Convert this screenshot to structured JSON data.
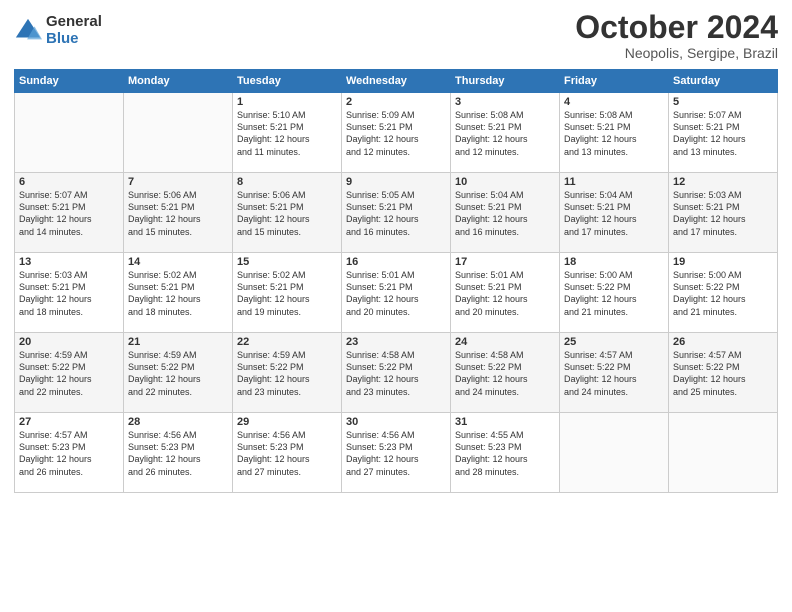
{
  "logo": {
    "general": "General",
    "blue": "Blue"
  },
  "header": {
    "title": "October 2024",
    "subtitle": "Neopolis, Sergipe, Brazil"
  },
  "weekdays": [
    "Sunday",
    "Monday",
    "Tuesday",
    "Wednesday",
    "Thursday",
    "Friday",
    "Saturday"
  ],
  "weeks": [
    [
      {
        "day": "",
        "info": ""
      },
      {
        "day": "",
        "info": ""
      },
      {
        "day": "1",
        "info": "Sunrise: 5:10 AM\nSunset: 5:21 PM\nDaylight: 12 hours\nand 11 minutes."
      },
      {
        "day": "2",
        "info": "Sunrise: 5:09 AM\nSunset: 5:21 PM\nDaylight: 12 hours\nand 12 minutes."
      },
      {
        "day": "3",
        "info": "Sunrise: 5:08 AM\nSunset: 5:21 PM\nDaylight: 12 hours\nand 12 minutes."
      },
      {
        "day": "4",
        "info": "Sunrise: 5:08 AM\nSunset: 5:21 PM\nDaylight: 12 hours\nand 13 minutes."
      },
      {
        "day": "5",
        "info": "Sunrise: 5:07 AM\nSunset: 5:21 PM\nDaylight: 12 hours\nand 13 minutes."
      }
    ],
    [
      {
        "day": "6",
        "info": "Sunrise: 5:07 AM\nSunset: 5:21 PM\nDaylight: 12 hours\nand 14 minutes."
      },
      {
        "day": "7",
        "info": "Sunrise: 5:06 AM\nSunset: 5:21 PM\nDaylight: 12 hours\nand 15 minutes."
      },
      {
        "day": "8",
        "info": "Sunrise: 5:06 AM\nSunset: 5:21 PM\nDaylight: 12 hours\nand 15 minutes."
      },
      {
        "day": "9",
        "info": "Sunrise: 5:05 AM\nSunset: 5:21 PM\nDaylight: 12 hours\nand 16 minutes."
      },
      {
        "day": "10",
        "info": "Sunrise: 5:04 AM\nSunset: 5:21 PM\nDaylight: 12 hours\nand 16 minutes."
      },
      {
        "day": "11",
        "info": "Sunrise: 5:04 AM\nSunset: 5:21 PM\nDaylight: 12 hours\nand 17 minutes."
      },
      {
        "day": "12",
        "info": "Sunrise: 5:03 AM\nSunset: 5:21 PM\nDaylight: 12 hours\nand 17 minutes."
      }
    ],
    [
      {
        "day": "13",
        "info": "Sunrise: 5:03 AM\nSunset: 5:21 PM\nDaylight: 12 hours\nand 18 minutes."
      },
      {
        "day": "14",
        "info": "Sunrise: 5:02 AM\nSunset: 5:21 PM\nDaylight: 12 hours\nand 18 minutes."
      },
      {
        "day": "15",
        "info": "Sunrise: 5:02 AM\nSunset: 5:21 PM\nDaylight: 12 hours\nand 19 minutes."
      },
      {
        "day": "16",
        "info": "Sunrise: 5:01 AM\nSunset: 5:21 PM\nDaylight: 12 hours\nand 20 minutes."
      },
      {
        "day": "17",
        "info": "Sunrise: 5:01 AM\nSunset: 5:21 PM\nDaylight: 12 hours\nand 20 minutes."
      },
      {
        "day": "18",
        "info": "Sunrise: 5:00 AM\nSunset: 5:22 PM\nDaylight: 12 hours\nand 21 minutes."
      },
      {
        "day": "19",
        "info": "Sunrise: 5:00 AM\nSunset: 5:22 PM\nDaylight: 12 hours\nand 21 minutes."
      }
    ],
    [
      {
        "day": "20",
        "info": "Sunrise: 4:59 AM\nSunset: 5:22 PM\nDaylight: 12 hours\nand 22 minutes."
      },
      {
        "day": "21",
        "info": "Sunrise: 4:59 AM\nSunset: 5:22 PM\nDaylight: 12 hours\nand 22 minutes."
      },
      {
        "day": "22",
        "info": "Sunrise: 4:59 AM\nSunset: 5:22 PM\nDaylight: 12 hours\nand 23 minutes."
      },
      {
        "day": "23",
        "info": "Sunrise: 4:58 AM\nSunset: 5:22 PM\nDaylight: 12 hours\nand 23 minutes."
      },
      {
        "day": "24",
        "info": "Sunrise: 4:58 AM\nSunset: 5:22 PM\nDaylight: 12 hours\nand 24 minutes."
      },
      {
        "day": "25",
        "info": "Sunrise: 4:57 AM\nSunset: 5:22 PM\nDaylight: 12 hours\nand 24 minutes."
      },
      {
        "day": "26",
        "info": "Sunrise: 4:57 AM\nSunset: 5:22 PM\nDaylight: 12 hours\nand 25 minutes."
      }
    ],
    [
      {
        "day": "27",
        "info": "Sunrise: 4:57 AM\nSunset: 5:23 PM\nDaylight: 12 hours\nand 26 minutes."
      },
      {
        "day": "28",
        "info": "Sunrise: 4:56 AM\nSunset: 5:23 PM\nDaylight: 12 hours\nand 26 minutes."
      },
      {
        "day": "29",
        "info": "Sunrise: 4:56 AM\nSunset: 5:23 PM\nDaylight: 12 hours\nand 27 minutes."
      },
      {
        "day": "30",
        "info": "Sunrise: 4:56 AM\nSunset: 5:23 PM\nDaylight: 12 hours\nand 27 minutes."
      },
      {
        "day": "31",
        "info": "Sunrise: 4:55 AM\nSunset: 5:23 PM\nDaylight: 12 hours\nand 28 minutes."
      },
      {
        "day": "",
        "info": ""
      },
      {
        "day": "",
        "info": ""
      }
    ]
  ]
}
